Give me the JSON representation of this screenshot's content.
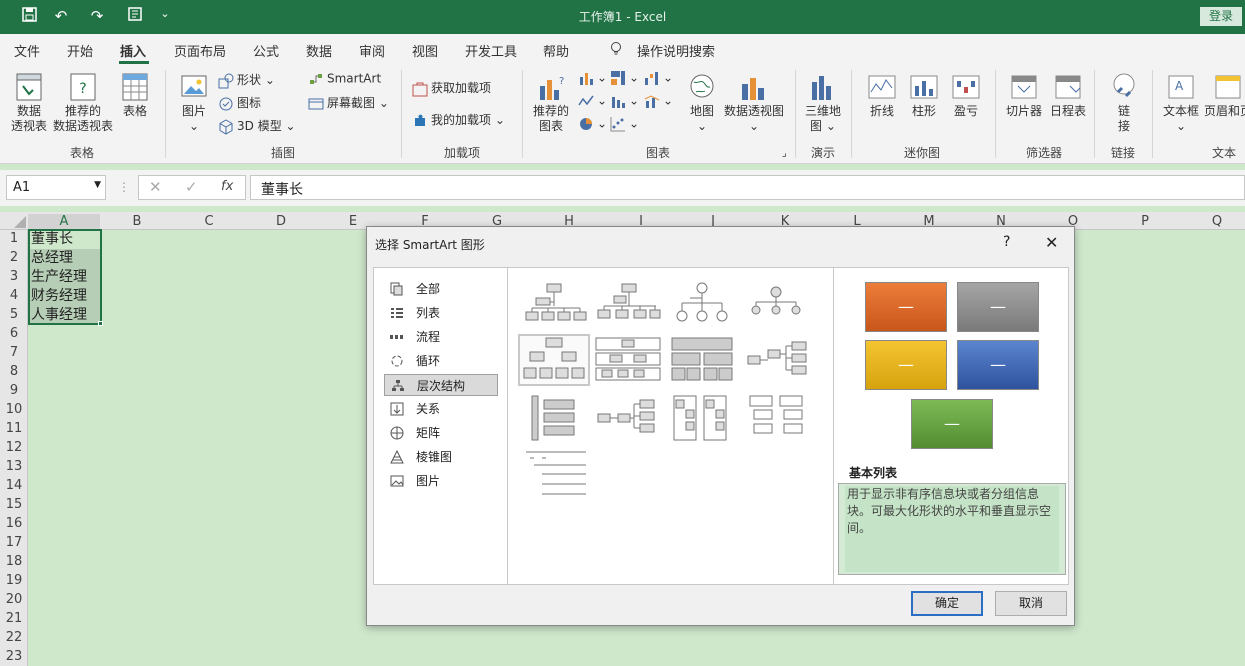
{
  "titlebar": {
    "title": "工作簿1  -  Excel",
    "login": "登录",
    "bg": "#217346"
  },
  "menu": {
    "tabs": [
      "文件",
      "开始",
      "插入",
      "页面布局",
      "公式",
      "数据",
      "审阅",
      "视图",
      "开发工具",
      "帮助"
    ],
    "active": "插入",
    "tell_me": "操作说明搜索"
  },
  "ribbon": {
    "tables": {
      "pivot_line1": "数据",
      "pivot_line2": "透视表",
      "rec_pivot_line1": "推荐的",
      "rec_pivot_line2": "数据透视表",
      "table": "表格",
      "group": "表格"
    },
    "illustrations": {
      "pictures": "图片",
      "shapes": "形状",
      "icons": "图标",
      "models": "3D 模型",
      "smartart": "SmartArt",
      "screenshot": "屏幕截图",
      "group": "插图"
    },
    "addins": {
      "get": "获取加载项",
      "my": "我的加载项",
      "group": "加载项"
    },
    "charts": {
      "rec_line1": "推荐的",
      "rec_line2": "图表",
      "maps": "地图",
      "pivotchart": "数据透视图",
      "group": "图表"
    },
    "tours": {
      "map3d_line1": "三维地",
      "map3d_line2": "图",
      "group": "演示"
    },
    "sparklines": {
      "line": "折线",
      "column": "柱形",
      "winloss": "盈亏",
      "group": "迷你图"
    },
    "filters": {
      "slicer": "切片器",
      "timeline": "日程表",
      "group": "筛选器"
    },
    "links": {
      "link_line1": "链",
      "link_line2": "接",
      "group": "链接"
    },
    "text": {
      "textbox": "文本框",
      "headerfooter": "页眉和页",
      "group": "文本"
    }
  },
  "formula_bar": {
    "name_box": "A1",
    "formula": "董事长"
  },
  "grid": {
    "columns": [
      "A",
      "B",
      "C",
      "D",
      "E",
      "F",
      "G",
      "H",
      "I",
      "J",
      "K",
      "L",
      "M",
      "N",
      "O",
      "P",
      "Q"
    ],
    "rows": [
      "1",
      "2",
      "3",
      "4",
      "5",
      "6",
      "7",
      "8",
      "9",
      "10",
      "11",
      "12",
      "13",
      "14",
      "15",
      "16",
      "17",
      "18",
      "19",
      "20",
      "21",
      "22",
      "23"
    ],
    "cells_A": [
      "董事长",
      "总经理",
      "生产经理",
      "财务经理",
      "人事经理"
    ]
  },
  "dialog": {
    "title": "选择 SmartArt 图形",
    "help": "?",
    "close": "✕",
    "categories": [
      "全部",
      "列表",
      "流程",
      "循环",
      "层次结构",
      "关系",
      "矩阵",
      "棱锥图",
      "图片"
    ],
    "selected_category": "层次结构",
    "preview_name": "基本列表",
    "preview_desc": "用于显示非有序信息块或者分组信息块。可最大化形状的水平和垂直显示空间。",
    "preview_colors": [
      "#e26b27",
      "#8c8c8c",
      "#e2b31a",
      "#3f68b5",
      "#6aa040"
    ],
    "ok": "确定",
    "cancel": "取消"
  }
}
